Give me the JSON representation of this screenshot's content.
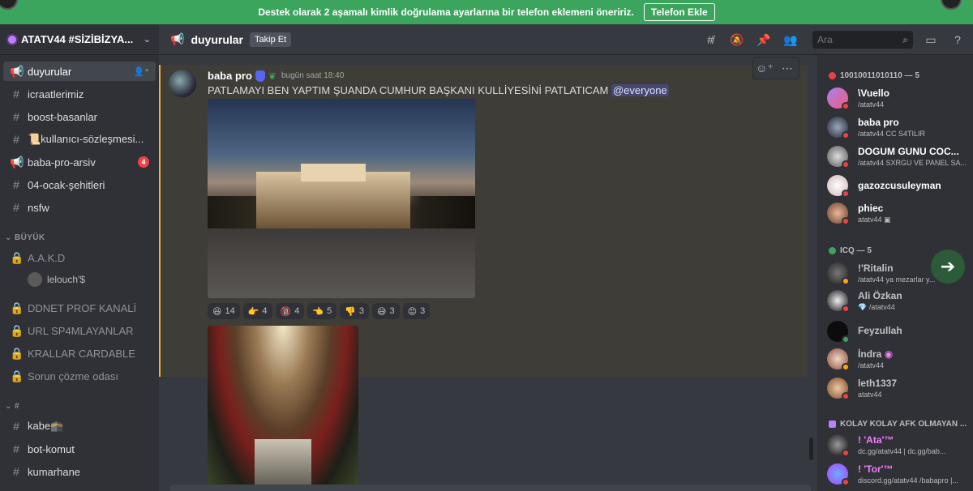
{
  "banner": {
    "message": "Destek olarak 2 aşamalı kimlik doğrulama ayarlarına bir telefon eklemeni öneririz.",
    "button": "Telefon Ekle"
  },
  "server": {
    "name": "ATATV44 #SİZİBİZYA..."
  },
  "sidebar": {
    "channels_top": [
      {
        "label": "duyurular",
        "icon": "megaphone-icon",
        "active": true
      },
      {
        "label": "icraatlerimiz",
        "icon": "hash-icon"
      },
      {
        "label": "boost-basanlar",
        "icon": "hash-icon"
      },
      {
        "label": "📜kullanıcı-sözleşmesi...",
        "icon": "hash-icon"
      },
      {
        "label": "baba-pro-arsiv",
        "icon": "megaphone-icon",
        "badge": "4"
      },
      {
        "label": "04-ocak-şehitleri",
        "icon": "hash-icon"
      },
      {
        "label": "nsfw",
        "icon": "hash-icon"
      }
    ],
    "category_big": "BÜYÜK",
    "voice_channels": [
      {
        "label": "A.A.K.D",
        "icon": "lock-icon"
      },
      {
        "label": "DDNET PROF KANALİ",
        "icon": "lock-icon"
      },
      {
        "label": "URL SP4MLAYANLAR",
        "icon": "lock-icon"
      },
      {
        "label": "KRALLAR CARDABLE",
        "icon": "lock-icon"
      },
      {
        "label": "Sorun çözme odası",
        "icon": "lock-icon"
      }
    ],
    "voice_user": "lelouch'$",
    "category_hash": "#",
    "channels_bottom": [
      {
        "label": "kabe🕋"
      },
      {
        "label": "bot-komut"
      },
      {
        "label": "kumarhane"
      }
    ]
  },
  "topbar": {
    "channel": "duyurular",
    "follow": "Takip Et",
    "search_placeholder": "Ara"
  },
  "message": {
    "author": "baba pro",
    "time": "bugün saat 18:40",
    "text": "PATLAMAYI BEN YAPTIM ŞUANDA CUMHUR BAŞKANI KULLİYESİNİ PATLATICAM",
    "mention": "@everyone",
    "reactions": [
      {
        "emoji": "😆",
        "count": "14"
      },
      {
        "emoji": "👉",
        "count": "4"
      },
      {
        "emoji": "🔞",
        "count": "4"
      },
      {
        "emoji": "👈",
        "count": "5"
      },
      {
        "emoji": "👎",
        "count": "3"
      },
      {
        "emoji": "😅",
        "count": "3"
      },
      {
        "emoji": "😡",
        "count": "3"
      }
    ]
  },
  "members": {
    "group1": {
      "title": "10010011010110 — 5",
      "color": "#ed4245"
    },
    "group1_members": [
      {
        "name": "\\Vuello",
        "sub": "/atatv44"
      },
      {
        "name": "baba pro",
        "sub": "/atatv44 CC S4TILIR"
      },
      {
        "name": "DOGUM GUNU COC...",
        "sub": "/atatv44 SXRGU VE PANEL SA..."
      },
      {
        "name": "gazozcusuleyman",
        "sub": ""
      },
      {
        "name": "phiec",
        "sub": "atatv44 ▣"
      }
    ],
    "group2": {
      "title": "ICQ — 5",
      "color": "#3ba55d"
    },
    "group2_members": [
      {
        "name": "!'Ritalin",
        "sub": "/atatv44 ya mezarlar y..."
      },
      {
        "name": "Ali Özkan",
        "sub": "💎 /atatv44"
      },
      {
        "name": "Feyzullah",
        "sub": ""
      },
      {
        "name": "İndra",
        "sub": "/atatv44"
      },
      {
        "name": "leth1337",
        "sub": "atatv44"
      }
    ],
    "group3": {
      "title": "KOLAY KOLAY AFK OLMAYAN ...",
      "color": "#b97fff"
    },
    "group3_members": [
      {
        "name": "! 'Ata'™",
        "sub": "dc.gg/atatv44 | dc.gg/bab..."
      },
      {
        "name": "! 'Tor'™",
        "sub": "discord.gg/atatv44 /babapro |..."
      }
    ]
  }
}
